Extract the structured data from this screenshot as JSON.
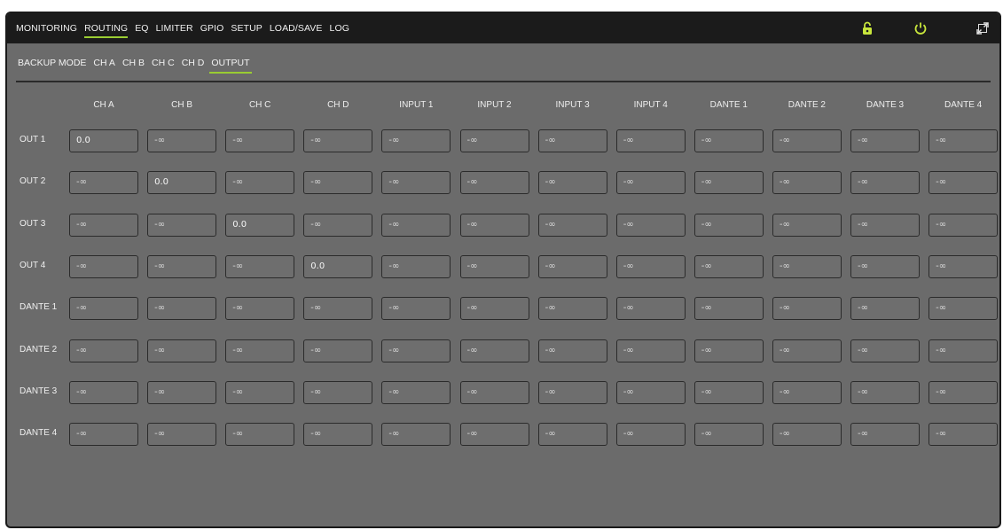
{
  "nav": {
    "tabs": [
      "MONITORING",
      "ROUTING",
      "EQ",
      "LIMITER",
      "GPIO",
      "SETUP",
      "LOAD/SAVE",
      "LOG"
    ],
    "active_tab": "ROUTING"
  },
  "icons": {
    "lock": "lock-icon",
    "power": "power-icon",
    "expand": "expand-icon",
    "accent": "#9acd32",
    "icon_color": "#c8e63c"
  },
  "subnav": {
    "items": [
      "BACKUP MODE",
      "CH A",
      "CH B",
      "CH C",
      "CH D",
      "OUTPUT"
    ],
    "active": "OUTPUT"
  },
  "matrix": {
    "columns": [
      "CH A",
      "CH B",
      "CH C",
      "CH D",
      "INPUT 1",
      "INPUT 2",
      "INPUT 3",
      "INPUT 4",
      "DANTE 1",
      "DANTE 2",
      "DANTE 3",
      "DANTE 4"
    ],
    "rows": [
      {
        "label": "OUT 1",
        "values": [
          "0.0",
          "-∞",
          "-∞",
          "-∞",
          "-∞",
          "-∞",
          "-∞",
          "-∞",
          "-∞",
          "-∞",
          "-∞",
          "-∞"
        ]
      },
      {
        "label": "OUT 2",
        "values": [
          "-∞",
          "0.0",
          "-∞",
          "-∞",
          "-∞",
          "-∞",
          "-∞",
          "-∞",
          "-∞",
          "-∞",
          "-∞",
          "-∞"
        ]
      },
      {
        "label": "OUT 3",
        "values": [
          "-∞",
          "-∞",
          "0.0",
          "-∞",
          "-∞",
          "-∞",
          "-∞",
          "-∞",
          "-∞",
          "-∞",
          "-∞",
          "-∞"
        ]
      },
      {
        "label": "OUT 4",
        "values": [
          "-∞",
          "-∞",
          "-∞",
          "0.0",
          "-∞",
          "-∞",
          "-∞",
          "-∞",
          "-∞",
          "-∞",
          "-∞",
          "-∞"
        ]
      },
      {
        "label": "DANTE 1",
        "values": [
          "-∞",
          "-∞",
          "-∞",
          "-∞",
          "-∞",
          "-∞",
          "-∞",
          "-∞",
          "-∞",
          "-∞",
          "-∞",
          "-∞"
        ]
      },
      {
        "label": "DANTE 2",
        "values": [
          "-∞",
          "-∞",
          "-∞",
          "-∞",
          "-∞",
          "-∞",
          "-∞",
          "-∞",
          "-∞",
          "-∞",
          "-∞",
          "-∞"
        ]
      },
      {
        "label": "DANTE 3",
        "values": [
          "-∞",
          "-∞",
          "-∞",
          "-∞",
          "-∞",
          "-∞",
          "-∞",
          "-∞",
          "-∞",
          "-∞",
          "-∞",
          "-∞"
        ]
      },
      {
        "label": "DANTE 4",
        "values": [
          "-∞",
          "-∞",
          "-∞",
          "-∞",
          "-∞",
          "-∞",
          "-∞",
          "-∞",
          "-∞",
          "-∞",
          "-∞",
          "-∞"
        ]
      }
    ]
  }
}
